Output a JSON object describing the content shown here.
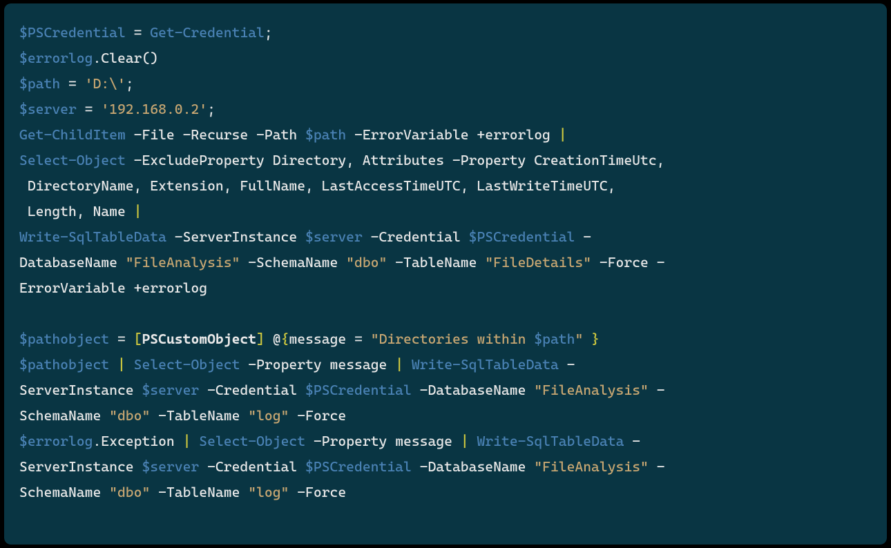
{
  "tokens": {
    "0": "$PSCredential",
    "1": " = ",
    "2": "Get-Credential",
    "3": ";",
    "4": "$errorlog",
    "5": ".Clear()",
    "6": "$path",
    "7": " = ",
    "8": "'D:\\'",
    "9": ";",
    "10": "$server",
    "11": " = ",
    "12": "'192.168.0.2'",
    "13": ";",
    "14": "Get-ChildItem",
    "15": " -File -Recurse -Path ",
    "16": "$path",
    "17": " -ErrorVariable +errorlog ",
    "18": "|",
    "19": "Select-Object",
    "20": " -ExcludeProperty Directory, Attributes -Property CreationTimeUtc,",
    "21": " DirectoryName, Extension, FullName, LastAccessTimeUTC, LastWriteTimeUTC,",
    "22": " Length, Name ",
    "23": "|",
    "24": "Write-SqlTableData",
    "25": " -ServerInstance ",
    "26": "$server",
    "27": " -Credential ",
    "28": "$PSCredential",
    "29": " -",
    "30": "DatabaseName ",
    "31": "\"FileAnalysis\"",
    "32": " -SchemaName ",
    "33": "\"dbo\"",
    "34": " -TableName ",
    "35": "\"FileDetails\"",
    "36": " -Force -",
    "37": "ErrorVariable +errorlog",
    "38": " ",
    "39": "$pathobject",
    "40": " = ",
    "41": "[",
    "42": "PSCustomObject",
    "43": "]",
    "44": " @",
    "45": "{",
    "46": "message = ",
    "47": "\"Directories within ",
    "48": "$path",
    "49": "\"",
    "50": " ",
    "51": "}",
    "52": "$pathobject",
    "53": " ",
    "54": "|",
    "55": " ",
    "56": "Select-Object",
    "57": " -Property message ",
    "58": "|",
    "59": " ",
    "60": "Write-SqlTableData",
    "61": " -",
    "62": "ServerInstance ",
    "63": "$server",
    "64": " -Credential ",
    "65": "$PSCredential",
    "66": " -DatabaseName ",
    "67": "\"FileAnalysis\"",
    "68": " -",
    "69": "SchemaName ",
    "70": "\"dbo\"",
    "71": " -TableName ",
    "72": "\"log\"",
    "73": " -Force",
    "74": "$errorlog",
    "75": ".Exception",
    "76": " ",
    "77": "|",
    "78": " ",
    "79": "Select-Object",
    "80": " -Property message ",
    "81": "|",
    "82": " ",
    "83": "Write-SqlTableData",
    "84": " -",
    "85": "ServerInstance ",
    "86": "$server",
    "87": " -Credential ",
    "88": "$PSCredential",
    "89": " -DatabaseName ",
    "90": "\"FileAnalysis\"",
    "91": " -",
    "92": "SchemaName ",
    "93": "\"dbo\"",
    "94": " -TableName ",
    "95": "\"log\"",
    "96": " -Force"
  }
}
